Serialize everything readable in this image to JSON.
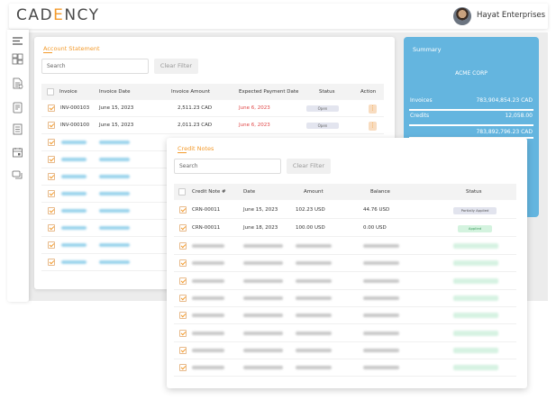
{
  "header": {
    "logo_prefix": "CAD",
    "logo_e": "E",
    "logo_suffix": "NCY",
    "company": "Hayat Enterprises"
  },
  "colors": {
    "accent": "#f39a2b",
    "summary_bg": "#64b5df",
    "due_red": "#e04646"
  },
  "sidebar": {
    "icons": [
      "menu-icon",
      "dashboard-icon",
      "invoice-icon",
      "document-icon",
      "report-icon",
      "calendar-icon",
      "messages-icon"
    ]
  },
  "account": {
    "title": "Account Statement",
    "search_placeholder": "Search",
    "clear_filter": "Clear Filter",
    "columns": [
      "Invoice",
      "Invoice Date",
      "Invoice Amount",
      "Expected Payment Date",
      "Status",
      "Action"
    ],
    "rows": [
      {
        "invoice": "INV-000103",
        "date": "June 15, 2023",
        "amount": "2,511.23 CAD",
        "expected": "June 6, 2023",
        "status": "Open"
      },
      {
        "invoice": "INV-000100",
        "date": "June 15, 2023",
        "amount": "2,011.23 CAD",
        "expected": "June 6, 2023",
        "status": "Open"
      }
    ]
  },
  "summary": {
    "title": "Summary",
    "company": "ACME CORP",
    "invoices_label": "Invoices",
    "invoices_value": "783,904,854.23 CAD",
    "credits_label": "Credits",
    "credits_value": "12,058.00",
    "total_value": "783,892,796.23 CAD"
  },
  "credit": {
    "title": "Credit Notes",
    "search_placeholder": "Search",
    "clear_filter": "Clear Filter",
    "columns": [
      "Credit Note #",
      "Date",
      "Amount",
      "Balance",
      "Status"
    ],
    "rows": [
      {
        "note": "CRN-00011",
        "date": "June 15, 2023",
        "amount": "102.23 USD",
        "balance": "44.76 USD",
        "status": "Partially Applied"
      },
      {
        "note": "CRN-00011",
        "date": "June 18, 2023",
        "amount": "100.00 USD",
        "balance": "0.00 USD",
        "status": "Applied"
      }
    ]
  }
}
